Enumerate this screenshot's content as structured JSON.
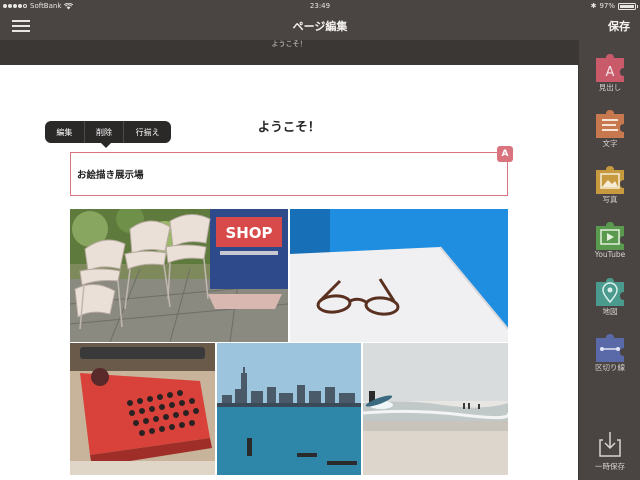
{
  "status_bar": {
    "carrier": "SoftBank",
    "time": "23:49",
    "battery": "97%",
    "battery_level": 0.97
  },
  "nav": {
    "title": "ページ編集",
    "save": "保存"
  },
  "page_header": {
    "text": "ようこそ！"
  },
  "content": {
    "title": "ようこそ！",
    "edit_menu": [
      "編集",
      "削除",
      "行揃え"
    ],
    "heading_block_text": "お絵描き展示場",
    "badge_icon": "A"
  },
  "photos": [
    {
      "name": "chairs-shop-photo",
      "sign_text": "SHOP"
    },
    {
      "name": "glasses-photo"
    },
    {
      "name": "typewriter-photo"
    },
    {
      "name": "city-skyline-photo"
    },
    {
      "name": "surfer-beach-photo"
    }
  ],
  "sidebar": {
    "tools": [
      {
        "label": "見出し",
        "color": "#c85a6a",
        "icon": "heading-icon"
      },
      {
        "label": "文字",
        "color": "#c8784e",
        "icon": "text-icon"
      },
      {
        "label": "写真",
        "color": "#c89a40",
        "icon": "photo-icon"
      },
      {
        "label": "YouTube",
        "color": "#5a9a4e",
        "icon": "youtube-icon"
      },
      {
        "label": "地図",
        "color": "#4a9a8e",
        "icon": "map-icon"
      },
      {
        "label": "区切り線",
        "color": "#5a6aa8",
        "icon": "divider-icon"
      }
    ],
    "temp_save": "一時保存"
  }
}
